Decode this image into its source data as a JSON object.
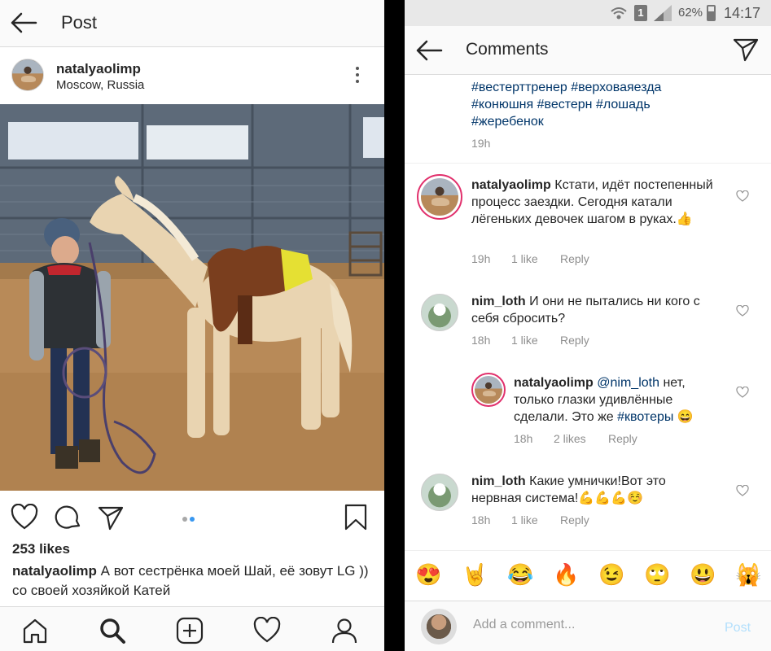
{
  "left": {
    "header": {
      "title": "Post"
    },
    "author": {
      "username": "natalyaolimp",
      "location": "Moscow, Russia"
    },
    "likes": "253 likes",
    "caption": {
      "username": "natalyaolimp",
      "text": "А вот сестрёнка моей Шай, её зовут LG )) со своей хозяйкой Катей"
    },
    "nav": [
      "home-icon",
      "search-icon",
      "add-icon",
      "heart-icon",
      "profile-icon"
    ]
  },
  "right": {
    "status": {
      "battery": "62%",
      "time": "14:17",
      "sim": "1"
    },
    "header": {
      "title": "Comments"
    },
    "caption_tail": {
      "tags": "#вестерттренер #верховаяезда #конюшня #вестерн #лошадь #жеребенок",
      "time": "19h"
    },
    "comments": [
      {
        "username": "natalyaolimp",
        "text": "Кстати, идёт постепенный процесс заездки. Сегодня катали лёгеньких девочек шагом в руках.👍",
        "time": "19h",
        "likes": "1 like",
        "reply": "Reply"
      },
      {
        "username": "nim_loth",
        "text": "И они не пытались ни кого с себя сбросить?",
        "time": "18h",
        "likes": "1 like",
        "reply": "Reply"
      },
      {
        "username": "natalyaolimp",
        "mention": "@nim_loth",
        "text": "нет, только глазки удивлённые сделали. Это же",
        "tag": "#квотеры",
        "emoji": "😄",
        "time": "18h",
        "likes": "2 likes",
        "reply": "Reply"
      },
      {
        "username": "nim_loth",
        "text": "Какие умнички!Вот это нервная система!💪💪💪☺️",
        "time": "18h",
        "likes": "1 like",
        "reply": "Reply"
      }
    ],
    "emojis": [
      "😍",
      "🤘",
      "😂",
      "🔥",
      "😉",
      "🙄",
      "😃",
      "🙀"
    ],
    "add_comment": {
      "placeholder": "Add a comment...",
      "post_label": "Post"
    }
  }
}
